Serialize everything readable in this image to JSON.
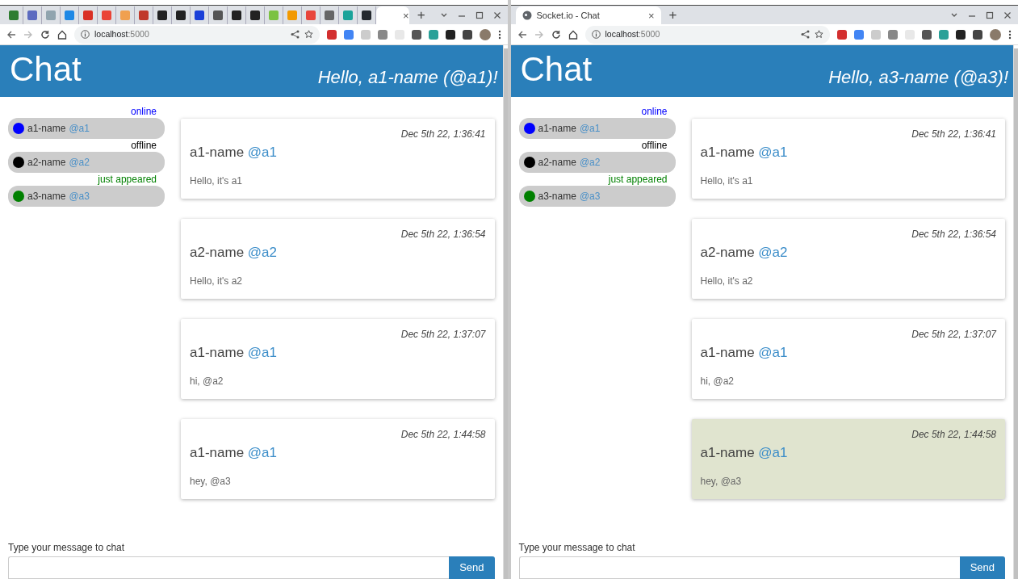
{
  "windows": [
    {
      "tabs": [
        {
          "selected": false,
          "color": "#2e7d32"
        },
        {
          "selected": false,
          "color": "#5c6bc0"
        },
        {
          "selected": false,
          "color": "#90a4ae"
        },
        {
          "selected": false,
          "color": "#1e88e5"
        },
        {
          "selected": false,
          "color": "#d93025"
        },
        {
          "selected": false,
          "color": "#ea4335"
        },
        {
          "selected": false,
          "color": "#f0a050"
        },
        {
          "selected": false,
          "color": "#c0392b"
        },
        {
          "selected": false,
          "color": "#222222"
        },
        {
          "selected": false,
          "color": "#222222"
        },
        {
          "selected": false,
          "color": "#1a3fd8"
        },
        {
          "selected": false,
          "color": "#555555"
        },
        {
          "selected": false,
          "color": "#222222"
        },
        {
          "selected": false,
          "color": "#222222"
        },
        {
          "selected": false,
          "color": "#7cc242"
        },
        {
          "selected": false,
          "color": "#f29900"
        },
        {
          "selected": false,
          "color": "#e8453c"
        },
        {
          "selected": false,
          "color": "#666666"
        },
        {
          "selected": false,
          "color": "#1aa39a"
        },
        {
          "selected": false,
          "color": "#24292e"
        },
        {
          "selected": true,
          "close": "×"
        }
      ],
      "new_tab": "+",
      "url_host": "localhost",
      "url_port": ":5000",
      "page": {
        "title": "Chat",
        "greeting": "Hello, a1-name (@a1)!",
        "users": [
          {
            "status": "online",
            "color": "#0000ff",
            "name": "a1-name",
            "handle": "@a1"
          },
          {
            "status": "offline",
            "color": "#000000",
            "name": "a2-name",
            "handle": "@a2"
          },
          {
            "status": "just appeared",
            "color": "#008000",
            "name": "a3-name",
            "handle": "@a3"
          }
        ],
        "messages": [
          {
            "time": "Dec 5th 22, 1:36:41",
            "name": "a1-name",
            "handle": "@a1",
            "text": "Hello, it's a1",
            "highlighted": false
          },
          {
            "time": "Dec 5th 22, 1:36:54",
            "name": "a2-name",
            "handle": "@a2",
            "text": "Hello, it's a2",
            "highlighted": false
          },
          {
            "time": "Dec 5th 22, 1:37:07",
            "name": "a1-name",
            "handle": "@a1",
            "text": "hi, @a2",
            "highlighted": false
          },
          {
            "time": "Dec 5th 22, 1:44:58",
            "name": "a1-name",
            "handle": "@a1",
            "text": "hey, @a3",
            "highlighted": false
          }
        ],
        "input_label": "Type your message to chat",
        "send": "Send"
      }
    },
    {
      "tabs": [
        {
          "selected": true,
          "title": "Socket.io - Chat",
          "close": "×"
        }
      ],
      "new_tab": "+",
      "url_host": "localhost",
      "url_port": ":5000",
      "page": {
        "title": "Chat",
        "greeting": "Hello, a3-name (@a3)!",
        "users": [
          {
            "status": "online",
            "color": "#0000ff",
            "name": "a1-name",
            "handle": "@a1"
          },
          {
            "status": "offline",
            "color": "#000000",
            "name": "a2-name",
            "handle": "@a2"
          },
          {
            "status": "just appeared",
            "color": "#008000",
            "name": "a3-name",
            "handle": "@a3"
          }
        ],
        "messages": [
          {
            "time": "Dec 5th 22, 1:36:41",
            "name": "a1-name",
            "handle": "@a1",
            "text": "Hello, it's a1",
            "highlighted": false
          },
          {
            "time": "Dec 5th 22, 1:36:54",
            "name": "a2-name",
            "handle": "@a2",
            "text": "Hello, it's a2",
            "highlighted": false
          },
          {
            "time": "Dec 5th 22, 1:37:07",
            "name": "a1-name",
            "handle": "@a1",
            "text": "hi, @a2",
            "highlighted": false
          },
          {
            "time": "Dec 5th 22, 1:44:58",
            "name": "a1-name",
            "handle": "@a1",
            "text": "hey, @a3",
            "highlighted": true
          }
        ],
        "input_label": "Type your message to chat",
        "send": "Send"
      }
    }
  ]
}
